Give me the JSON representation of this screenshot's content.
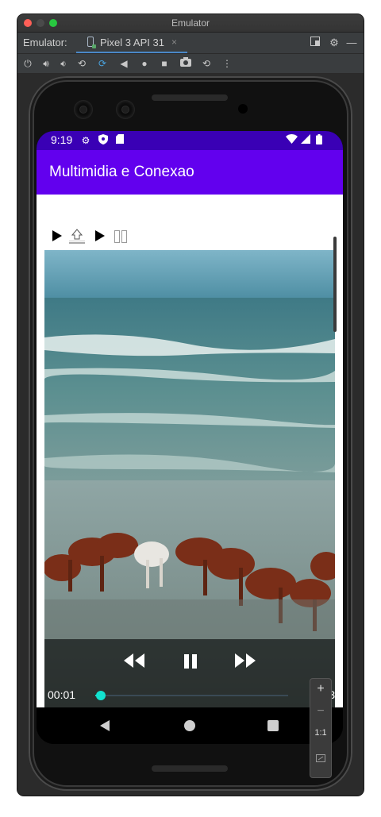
{
  "window": {
    "title": "Emulator",
    "label": "Emulator:",
    "tab_label": "Pixel 3 API 31",
    "tab_close": "×"
  },
  "emulator_toolbar": {
    "icons": [
      "power-icon",
      "volume-up-icon",
      "volume-down-icon",
      "rotate-left-icon",
      "rotate-right-icon",
      "back-icon",
      "home-icon",
      "overview-icon",
      "camera-icon",
      "snapshot-icon",
      "more-icon"
    ]
  },
  "status_bar": {
    "time": "9:19",
    "icons": [
      "settings-icon",
      "shield-icon",
      "sd-card-icon",
      "wifi-icon",
      "signal-icon",
      "battery-icon"
    ]
  },
  "app": {
    "title": "Multimidia e Conexao"
  },
  "video_player": {
    "current_time": "00:01",
    "duration": "00:30",
    "progress": 0.03,
    "colors": {
      "seek_fill": "#00d8c8",
      "app_bar": "#6200ee",
      "status_bar": "#3a00b5"
    }
  },
  "zoom_panel": {
    "plus": "+",
    "minus": "−",
    "ratio": "1:1"
  }
}
